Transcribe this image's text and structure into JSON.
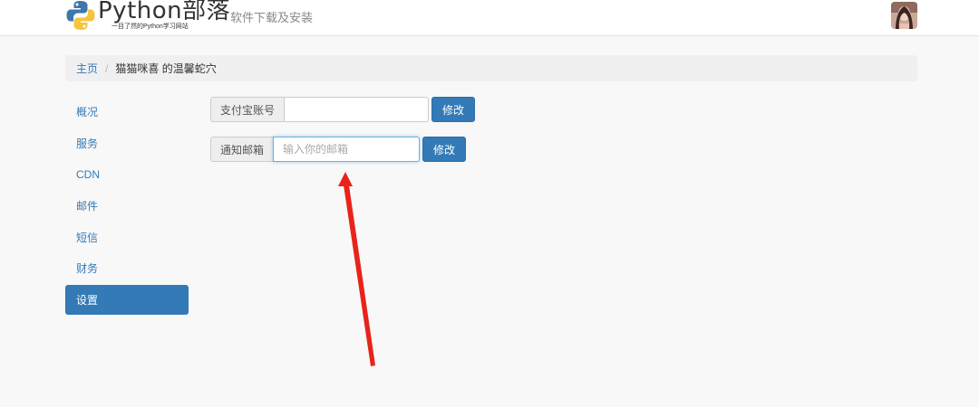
{
  "header": {
    "logo_title": "Python部落",
    "logo_tagline": "一目了然的Python学习网站",
    "nav_link": "软件下载及安装"
  },
  "breadcrumb": {
    "home": "主页",
    "separator": "/",
    "current": "猫猫咪喜 的温馨蛇穴"
  },
  "sidebar": {
    "items": [
      {
        "label": "概况"
      },
      {
        "label": "服务"
      },
      {
        "label": "CDN"
      },
      {
        "label": "邮件"
      },
      {
        "label": "短信"
      },
      {
        "label": "财务"
      },
      {
        "label": "设置",
        "active": true
      }
    ]
  },
  "settings": {
    "alipay": {
      "label": "支付宝账号",
      "value": "",
      "button": "修改"
    },
    "email": {
      "label": "通知邮箱",
      "placeholder": "输入你的邮箱",
      "value": "",
      "button": "修改"
    }
  },
  "colors": {
    "primary": "#337ab7",
    "arrow": "#e8231a"
  }
}
